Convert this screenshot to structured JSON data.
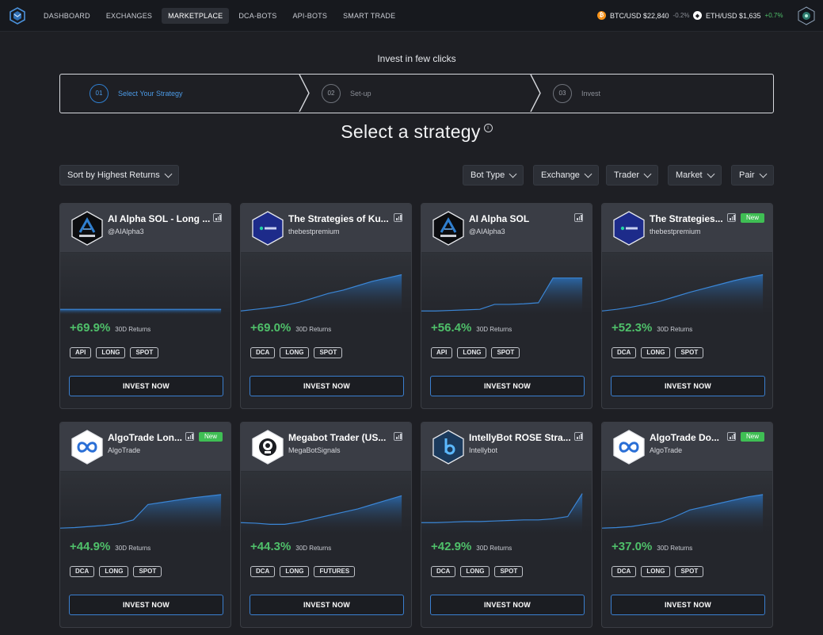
{
  "nav": {
    "items": [
      "DASHBOARD",
      "EXCHANGES",
      "MARKETPLACE",
      "DCA-BOTS",
      "API-BOTS",
      "SMART TRADE"
    ],
    "active_index": 2
  },
  "tickers": [
    {
      "pair": "BTC/USD $22,840",
      "change": "-0.2%",
      "coin_icon": "bitcoin-icon",
      "color": "#f7931a"
    },
    {
      "pair": "ETH/USD $1,635",
      "change": "+0.7%",
      "coin_icon": "ethereum-icon",
      "color": "#ffffff"
    }
  ],
  "intro": "Invest in few clicks",
  "steps": [
    {
      "num": "01",
      "label": "Select Your Strategy"
    },
    {
      "num": "02",
      "label": "Set-up"
    },
    {
      "num": "03",
      "label": "Invest"
    }
  ],
  "heading": "Select a strategy",
  "sort_label": "Sort by Highest Returns",
  "filters": [
    "Bot Type",
    "Exchange",
    "Trader",
    "Market",
    "Pair"
  ],
  "returns_label": "30D Returns",
  "invest_label": "INVEST NOW",
  "new_label": "New",
  "cards": [
    {
      "name": "AI Alpha SOL - Long ...",
      "author": "@AIAlpha3",
      "returns": "+69.9%",
      "tags": [
        "API",
        "LONG",
        "SPOT"
      ],
      "logo": "ai-alpha",
      "is_new": false,
      "series": [
        0.05,
        0.05,
        0.05,
        0.05,
        0.05,
        0.05,
        0.05,
        0.05,
        0.05,
        0.05,
        0.05,
        0.05
      ]
    },
    {
      "name": "The Strategies of Ku...",
      "author": "thebestpremium",
      "returns": "+69.0%",
      "tags": [
        "DCA",
        "LONG",
        "SPOT"
      ],
      "logo": "kucoin",
      "is_new": false,
      "series": [
        0.02,
        0.05,
        0.08,
        0.12,
        0.18,
        0.26,
        0.34,
        0.4,
        0.48,
        0.56,
        0.62,
        0.68
      ]
    },
    {
      "name": "AI Alpha SOL",
      "author": "@AIAlpha3",
      "returns": "+56.4%",
      "tags": [
        "API",
        "LONG",
        "SPOT"
      ],
      "logo": "ai-alpha",
      "is_new": false,
      "series": [
        0.02,
        0.02,
        0.03,
        0.04,
        0.05,
        0.14,
        0.14,
        0.15,
        0.17,
        0.62,
        0.62,
        0.62
      ]
    },
    {
      "name": "The Strategies...",
      "author": "thebestpremium",
      "returns": "+52.3%",
      "tags": [
        "DCA",
        "LONG",
        "SPOT"
      ],
      "logo": "kucoin",
      "is_new": true,
      "series": [
        0.02,
        0.05,
        0.09,
        0.14,
        0.2,
        0.28,
        0.36,
        0.43,
        0.5,
        0.57,
        0.63,
        0.68
      ]
    },
    {
      "name": "AlgoTrade Lon...",
      "author": "AlgoTrade",
      "returns": "+44.9%",
      "tags": [
        "DCA",
        "LONG",
        "SPOT"
      ],
      "logo": "algotrade",
      "is_new": true,
      "series": [
        0.05,
        0.06,
        0.08,
        0.1,
        0.13,
        0.2,
        0.48,
        0.52,
        0.56,
        0.6,
        0.63,
        0.66
      ]
    },
    {
      "name": "Megabot Trader (US...",
      "author": "MegaBotSignals",
      "returns": "+44.3%",
      "tags": [
        "DCA",
        "LONG",
        "FUTURES"
      ],
      "logo": "megabot",
      "is_new": false,
      "series": [
        0.15,
        0.14,
        0.12,
        0.12,
        0.16,
        0.22,
        0.28,
        0.34,
        0.4,
        0.48,
        0.56,
        0.64
      ]
    },
    {
      "name": "IntellyBot ROSE Stra...",
      "author": "Intellybot",
      "returns": "+42.9%",
      "tags": [
        "DCA",
        "LONG",
        "SPOT"
      ],
      "logo": "intellybot",
      "is_new": false,
      "series": [
        0.15,
        0.15,
        0.16,
        0.17,
        0.17,
        0.18,
        0.19,
        0.2,
        0.2,
        0.22,
        0.26,
        0.68
      ]
    },
    {
      "name": "AlgoTrade Do...",
      "author": "AlgoTrade",
      "returns": "+37.0%",
      "tags": [
        "DCA",
        "LONG",
        "SPOT"
      ],
      "logo": "algotrade",
      "is_new": true,
      "series": [
        0.05,
        0.06,
        0.08,
        0.12,
        0.16,
        0.26,
        0.38,
        0.44,
        0.5,
        0.56,
        0.62,
        0.66
      ]
    }
  ]
}
